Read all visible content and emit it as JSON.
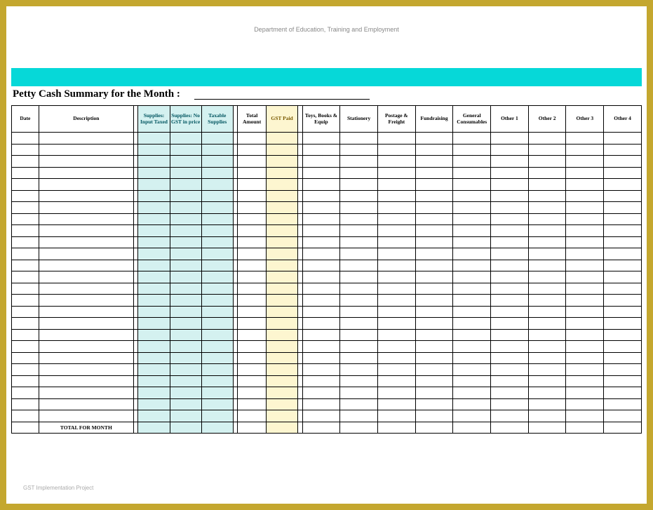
{
  "department": "Department of Education, Training and Employment",
  "title": "Petty Cash Summary for the Month :",
  "columns": {
    "date": "Date",
    "description": "Description",
    "supplies_input_taxed": "Supplies: Input Taxed",
    "supplies_no_gst": "Supplies: No GST in price",
    "taxable_supplies": "Taxable Supplies",
    "total_amount": "Total Amount",
    "gst_paid": "GST Paid",
    "toys_books_equip": "Toys, Books & Equip",
    "stationery": "Stationery",
    "postage_freight": "Postage & Freight",
    "fundraising": "Fundraising",
    "general_consumables": "General Consumables",
    "other1": "Other 1",
    "other2": "Other 2",
    "other3": "Other 3",
    "other4": "Other 4"
  },
  "row_count": 25,
  "total_label": "TOTAL FOR MONTH",
  "footer": "GST Implementation Project"
}
